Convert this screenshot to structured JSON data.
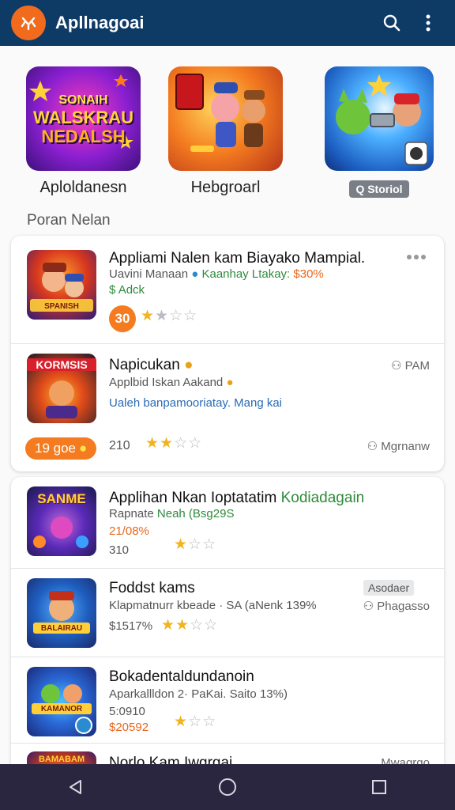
{
  "appbar": {
    "title": "Apllnagoai",
    "logo_icon": "compass-logo-icon",
    "search_icon": "search-icon",
    "menu_icon": "more-vert-icon",
    "bg_color": "#0e3a66",
    "accent": "#f26b1d"
  },
  "featured": [
    {
      "tile_text_1": "SONAIH",
      "tile_text_2": "WALSKRAU",
      "tile_text_3": "NEDALSH",
      "label": "Aploldanesn"
    },
    {
      "tile_text_1": "",
      "label": "Hebgroarl"
    },
    {
      "tile_text_1": "",
      "label": "Q Storiol"
    }
  ],
  "section_title": "Poran Nelan",
  "card1": {
    "rows": [
      {
        "title": "Appliami Nalen kam Biayako Mampial.",
        "sub1_a": "Uavini Manaan",
        "sub1_b": "Kaanhay Ltakay:",
        "sub1_c": "$30%",
        "sub2": "Adck",
        "thumb_text": "SPANISH",
        "badge": "30",
        "rating": 1,
        "more_icon": "more-horiz-icon"
      },
      {
        "title": "Napicukan",
        "sub1": "Applbid Iskan Aakand",
        "sub2": "Ualeh banpamooriatay. Mang kai",
        "thumb_text": "KORMSIS",
        "pill": "19 goe",
        "count": "210",
        "rating": 2,
        "right_top": "PAM",
        "right_bottom": "Mgrnanw"
      }
    ]
  },
  "card2": {
    "rows": [
      {
        "title_a": "Applihan Nkan Ioptatatim",
        "title_b": "Kodiadagain",
        "sub1_a": "Rapnate",
        "sub1_b": "Neah (Bsg29S",
        "sub2": "21/08%",
        "count": "310",
        "thumb_text": "SANME",
        "rating": 1
      },
      {
        "title": "Foddst kams",
        "sub1": "Klapmatnurr kbeade · SA (aNenk 139%",
        "count": "$1517%",
        "thumb_text": "BALAIRAU",
        "rating": 2,
        "chip": "Asodaer",
        "right_bottom": "Phagasso"
      },
      {
        "title": "Bokadentaldundanoin",
        "sub1": "Aparkallldon 2· PaKai. Saito 13%)",
        "sub2": "5:0910",
        "count": "$20592",
        "thumb_text": "KAMANOR",
        "rating": 1
      },
      {
        "title": "Norlo Kam Iwgrgai",
        "thumb_text": "BAMABAM",
        "right_top": "Mwagrgo"
      }
    ]
  },
  "navbar": {
    "back_icon": "back-triangle-icon",
    "home_icon": "home-circle-icon",
    "recents_icon": "recents-square-icon"
  }
}
